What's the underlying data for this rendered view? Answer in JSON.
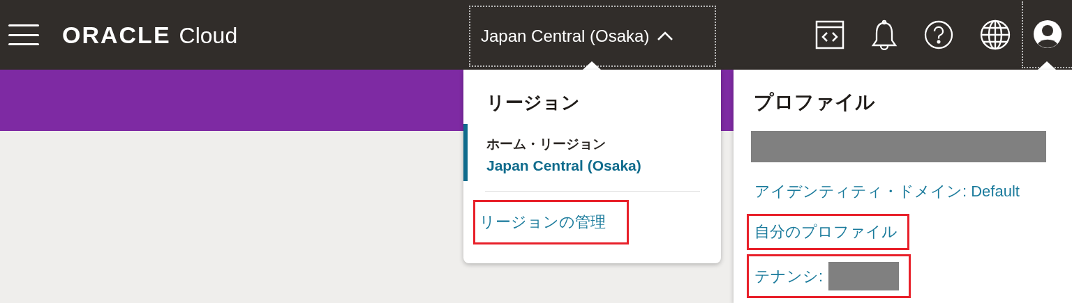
{
  "header": {
    "logo": {
      "brand": "ORACLE",
      "product": "Cloud"
    },
    "region_selector": {
      "label": "Japan Central (Osaka)",
      "expanded": true
    },
    "toolbar": [
      {
        "kind": "code"
      },
      {
        "kind": "bell"
      },
      {
        "kind": "help"
      },
      {
        "kind": "globe"
      }
    ],
    "profile_button": {
      "expanded": true
    }
  },
  "region_menu": {
    "title": "リージョン",
    "home_label": "ホーム・リージョン",
    "home_region": "Japan Central (Osaka)",
    "links": [
      {
        "label": "リージョンの管理",
        "highlighted": true
      }
    ]
  },
  "profile_menu": {
    "title": "プロファイル",
    "user_redacted": true,
    "items": [
      {
        "label": "アイデンティティ・ドメイン: Default",
        "highlighted": false,
        "redacted": false
      },
      {
        "label": "自分のプロファイル",
        "highlighted": true,
        "redacted": false
      },
      {
        "label": "テナンシ:",
        "highlighted": true,
        "redacted": true
      }
    ]
  }
}
